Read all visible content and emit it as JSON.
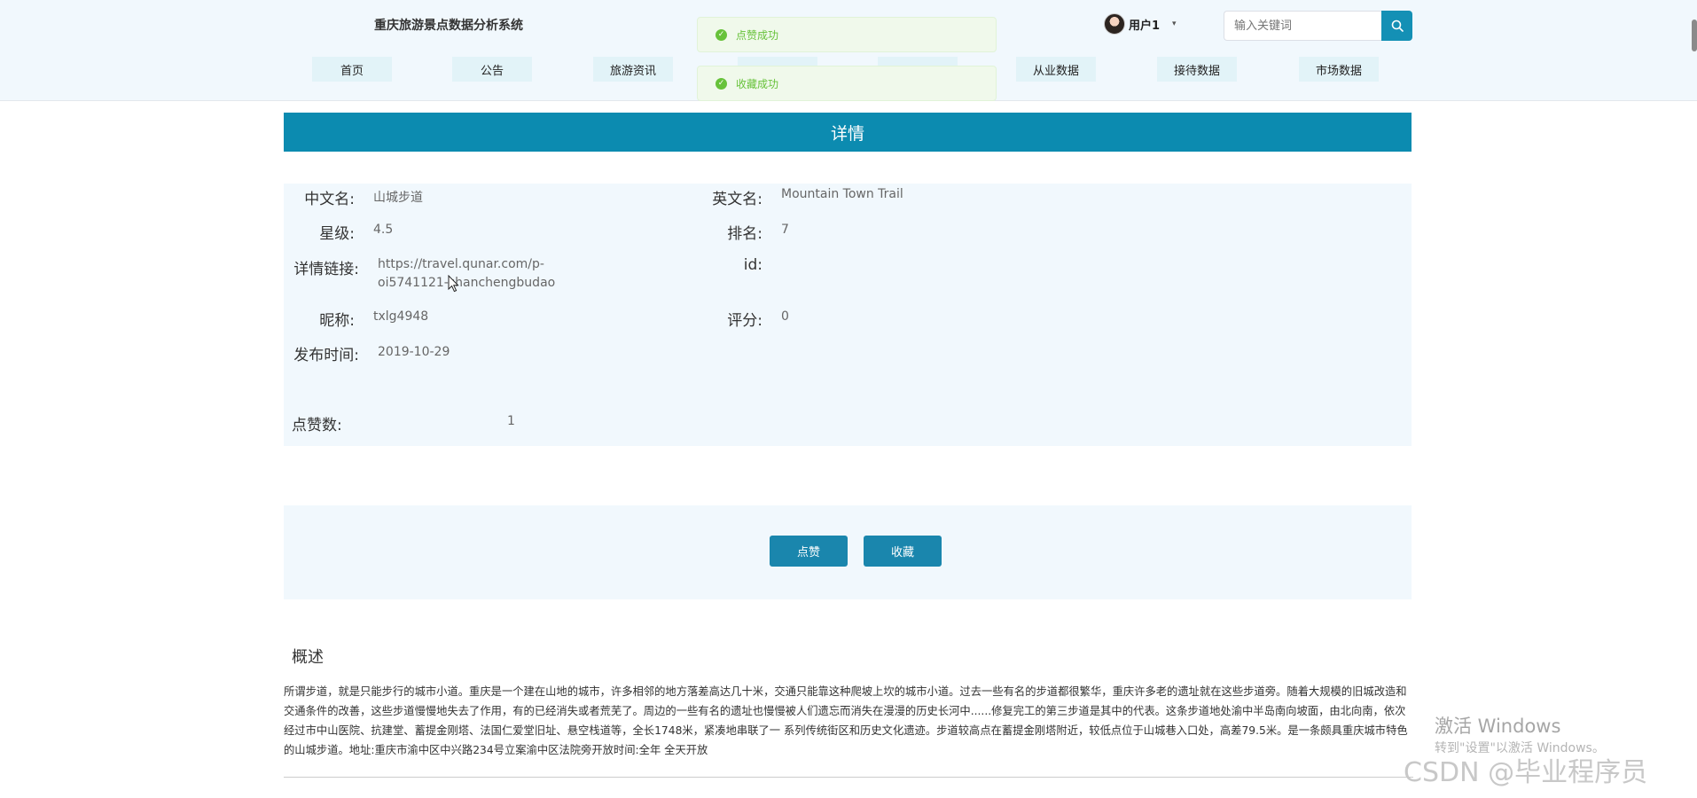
{
  "header": {
    "site_title": "重庆旅游景点数据分析系统",
    "user_name": "用户1",
    "caret": "▾",
    "search_placeholder": "输入关键词"
  },
  "nav": [
    {
      "label": "首页"
    },
    {
      "label": "公告"
    },
    {
      "label": "旅游资讯"
    },
    {
      "label": "从业数据"
    },
    {
      "label": "接待数据"
    },
    {
      "label": "市场数据"
    }
  ],
  "toasts": [
    {
      "text": "点赞成功"
    },
    {
      "text": "收藏成功"
    }
  ],
  "detail_title": "详情",
  "fields": {
    "cn_name": {
      "label": "中文名:",
      "value": "山城步道"
    },
    "en_name": {
      "label": "英文名:",
      "value": "Mountain Town Trail"
    },
    "stars": {
      "label": "星级:",
      "value": "4.5"
    },
    "rank": {
      "label": "排名:",
      "value": "7"
    },
    "link": {
      "label": "详情链接:",
      "value_line1": "https://travel.qunar.com/p-",
      "value_line2": "oi5741121-shanchengbudao"
    },
    "id": {
      "label": "id:",
      "value": ""
    },
    "nickname": {
      "label": "昵称:",
      "value": "txlg4948"
    },
    "score": {
      "label": "评分:",
      "value": "0"
    },
    "publish_time": {
      "label": "发布时间:",
      "value": "2019-10-29"
    },
    "likes": {
      "label": "点赞数:",
      "value": "1"
    }
  },
  "actions": {
    "like": "点赞",
    "favorite": "收藏"
  },
  "summary": {
    "title": "概述",
    "text": "所谓步道，就是只能步行的城市小道。重庆是一个建在山地的城市，许多相邻的地方落差高达几十米，交通只能靠这种爬坡上坎的城市小道。过去一些有名的步道都很繁华，重庆许多老的遗址就在这些步道旁。随着大规模的旧城改造和交通条件的改善，这些步道慢慢地失去了作用，有的已经消失或者荒芜了。周边的一些有名的遗址也慢慢被人们遗忘而消失在漫漫的历史长河中......修复完工的第三步道是其中的代表。这条步道地处渝中半岛南向坡面，由北向南，依次经过市中山医院、抗建堂、蓄提金刚塔、法国仁爱堂旧址、悬空栈道等，全长1748米，紧凑地串联了一 系列传统街区和历史文化遗迹。步道较高点在蓄提金刚塔附近，较低点位于山城巷入口处，高差79.5米。是一条颇具重庆城市特色的山城步道。地址:重庆市渝中区中兴路234号立案渝中区法院旁开放时间:全年 全天开放"
  },
  "watermark": {
    "line1": "激活 Windows",
    "line2": "转到\"设置\"以激活 Windows。",
    "csdn": "CSDN @毕业程序员"
  }
}
